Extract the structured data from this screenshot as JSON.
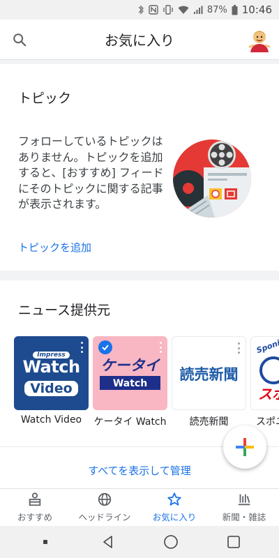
{
  "status_bar": {
    "battery": "87%",
    "time": "10:46",
    "icons": [
      "bluetooth-icon",
      "nfc-icon",
      "vibrate-icon",
      "wifi-icon",
      "signal-icon",
      "battery-icon"
    ]
  },
  "app_bar": {
    "title": "お気に入り",
    "search_icon": "search-icon",
    "avatar_icon": "avatar"
  },
  "topics": {
    "heading": "トピック",
    "description": "フォローしているトピックはありません。トピックを追加すると、[おすすめ] フィードにそのトピックに関する記事が表示されます。",
    "add_link": "トピックを追加"
  },
  "sources": {
    "heading": "ニュース提供元",
    "items": [
      {
        "label": "Watch Video",
        "logo_small": "Impress",
        "logo_main": "Watch",
        "logo_sub": "Video"
      },
      {
        "label": "ケータイ Watch",
        "logo_main": "ケータイ",
        "logo_sub": "Watch"
      },
      {
        "label": "読売新聞",
        "logo_main": "読売新聞"
      },
      {
        "label": "スポニ",
        "logo_main": "Sponichi",
        "logo_sub": "スポ"
      }
    ],
    "see_all": "すべてを表示して管理"
  },
  "fab": {
    "icon": "plus-icon"
  },
  "bottom_nav": [
    {
      "label": "おすすめ",
      "icon": "for-you-icon",
      "active": false
    },
    {
      "label": "ヘッドライン",
      "icon": "globe-icon",
      "active": false
    },
    {
      "label": "お気に入り",
      "icon": "star-icon",
      "active": true
    },
    {
      "label": "新聞・雑誌",
      "icon": "newsstand-icon",
      "active": false
    }
  ],
  "colors": {
    "accent": "#1a73e8",
    "watch_video_bg": "#1e4b8f",
    "keitai_bg": "#f9b6c3",
    "yomiuri_text": "#1d5ba8",
    "sponichi_blue": "#1c4aa0",
    "sponichi_red": "#e60012"
  }
}
